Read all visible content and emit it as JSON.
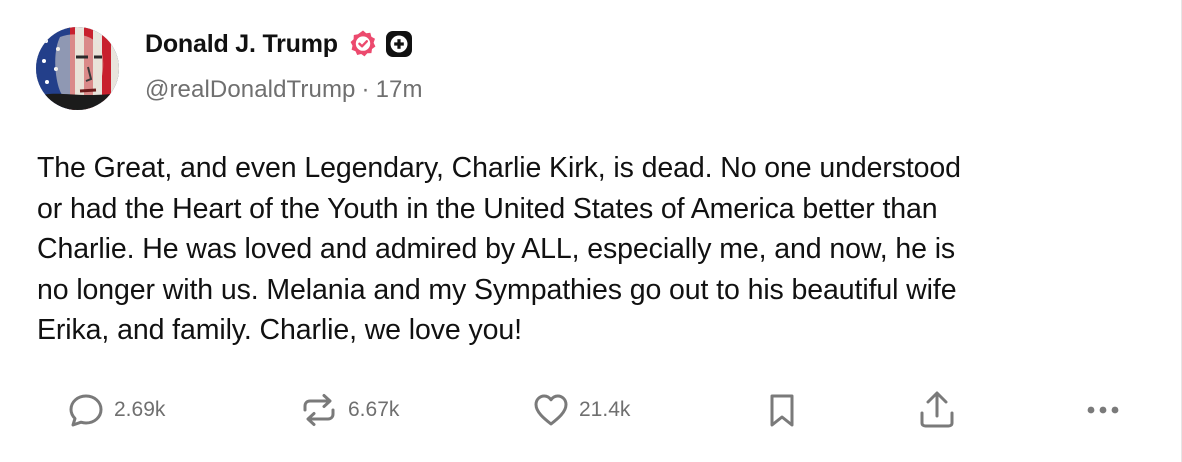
{
  "post": {
    "author": {
      "display_name": "Donald J. Trump",
      "handle": "@realDonaldTrump",
      "separator": "·",
      "time_ago": "17m"
    },
    "body_lines": [
      "The Great, and even Legendary, Charlie Kirk, is dead. No one understood",
      "or had the Heart of the Youth in the United States of America better than",
      "Charlie. He was loved and admired by ALL, especially me, and now, he is",
      "no longer with us. Melania and my Sympathies go out to his beautiful wife",
      "Erika, and family. Charlie, we love you!"
    ],
    "actions": {
      "replies": "2.69k",
      "reposts": "6.67k",
      "likes": "21.4k"
    }
  },
  "icons": {
    "verified": "verified-badge-icon",
    "plus": "plus-badge-icon",
    "reply": "speech-bubble-icon",
    "repost": "repost-arrows-icon",
    "like": "heart-icon",
    "bookmark": "bookmark-icon",
    "share": "share-upload-icon",
    "more": "more-dots-icon"
  },
  "colors": {
    "verified_badge": "#ec4a6e",
    "plus_badge": "#111111",
    "text_primary": "#111111",
    "text_secondary": "#6f6f6f",
    "icon_gray": "#7a7a7a"
  }
}
